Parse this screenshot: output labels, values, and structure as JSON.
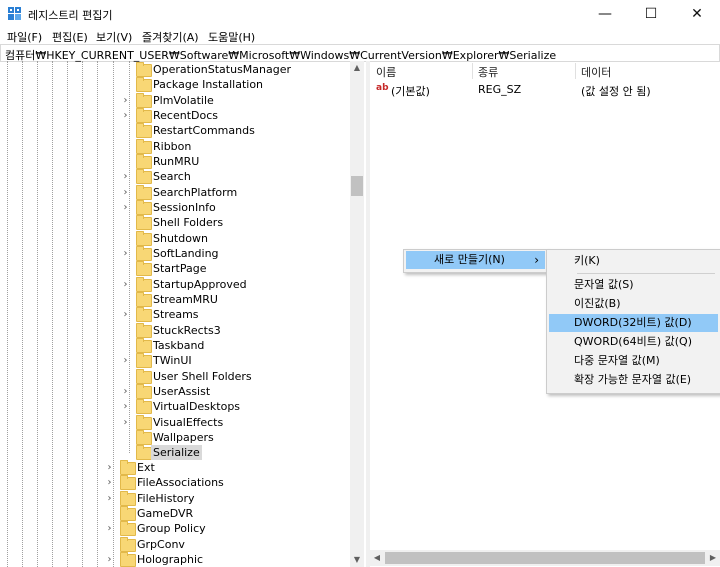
{
  "window": {
    "title": "레지스트리 편집기",
    "minimize_glyph": "—",
    "maximize_glyph": "☐",
    "close_glyph": "✕"
  },
  "menubar": [
    "파일(F)",
    "편집(E)",
    "보기(V)",
    "즐겨찾기(A)",
    "도움말(H)"
  ],
  "address": "컴퓨터₩HKEY_CURRENT_USER₩Software₩Microsoft₩Windows₩CurrentVersion₩Explorer₩Serialize",
  "tree": {
    "explorer_children": [
      {
        "label": "OperationStatusManager",
        "expandable": false
      },
      {
        "label": "Package Installation",
        "expandable": false
      },
      {
        "label": "PlmVolatile",
        "expandable": true
      },
      {
        "label": "RecentDocs",
        "expandable": true
      },
      {
        "label": "RestartCommands",
        "expandable": false
      },
      {
        "label": "Ribbon",
        "expandable": false
      },
      {
        "label": "RunMRU",
        "expandable": false
      },
      {
        "label": "Search",
        "expandable": true
      },
      {
        "label": "SearchPlatform",
        "expandable": true
      },
      {
        "label": "SessionInfo",
        "expandable": true
      },
      {
        "label": "Shell Folders",
        "expandable": false
      },
      {
        "label": "Shutdown",
        "expandable": false
      },
      {
        "label": "SoftLanding",
        "expandable": true
      },
      {
        "label": "StartPage",
        "expandable": false
      },
      {
        "label": "StartupApproved",
        "expandable": true
      },
      {
        "label": "StreamMRU",
        "expandable": false
      },
      {
        "label": "Streams",
        "expandable": true
      },
      {
        "label": "StuckRects3",
        "expandable": false
      },
      {
        "label": "Taskband",
        "expandable": false
      },
      {
        "label": "TWinUI",
        "expandable": true
      },
      {
        "label": "User Shell Folders",
        "expandable": false
      },
      {
        "label": "UserAssist",
        "expandable": true
      },
      {
        "label": "VirtualDesktops",
        "expandable": true
      },
      {
        "label": "VisualEffects",
        "expandable": true
      },
      {
        "label": "Wallpapers",
        "expandable": false
      },
      {
        "label": "Serialize",
        "expandable": false,
        "selected": true
      }
    ],
    "currentversion_children": [
      {
        "label": "Ext",
        "expandable": true
      },
      {
        "label": "FileAssociations",
        "expandable": true
      },
      {
        "label": "FileHistory",
        "expandable": true
      },
      {
        "label": "GameDVR",
        "expandable": false
      },
      {
        "label": "Group Policy",
        "expandable": true
      },
      {
        "label": "GrpConv",
        "expandable": false
      },
      {
        "label": "Holographic",
        "expandable": true
      }
    ]
  },
  "list": {
    "columns": [
      "이름",
      "종류",
      "데이터"
    ],
    "rows": [
      {
        "icon": "ab",
        "name": "(기본값)",
        "type": "REG_SZ",
        "data": "(값 설정 안 됨)"
      }
    ]
  },
  "context_menu": {
    "new_label": "새로 만들기(N)",
    "arrow": "›",
    "submenu": [
      {
        "label": "키(K)",
        "separator_after": true
      },
      {
        "label": "문자열 값(S)"
      },
      {
        "label": "이진값(B)"
      },
      {
        "label": "DWORD(32비트) 값(D)",
        "highlighted": true
      },
      {
        "label": "QWORD(64비트) 값(Q)"
      },
      {
        "label": "다중 문자열 값(M)"
      },
      {
        "label": "확장 가능한 문자열 값(E)"
      }
    ]
  },
  "scroll": {
    "up": "▲",
    "down": "▼",
    "left": "◀",
    "right": "▶"
  }
}
